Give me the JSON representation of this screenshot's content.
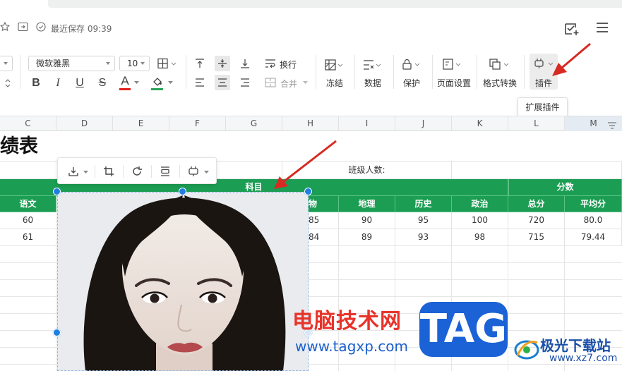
{
  "title_bar": {
    "save_status": "最近保存 09:39"
  },
  "toolbar": {
    "font_name": "微软雅黑",
    "font_size": "10",
    "wrap_label": "换行",
    "merge_label": "合并",
    "freeze_label": "冻结",
    "data_label": "数据",
    "protect_label": "保护",
    "page_setup_label": "页面设置",
    "format_convert_label": "格式转换",
    "plugin_label": "插件",
    "bold": "B",
    "italic": "I",
    "underline": "U",
    "strike": "S",
    "font_color": "A",
    "colors": {
      "font_color": "#e0201c",
      "fill_color": "#2aa55a"
    }
  },
  "tooltip": {
    "text": "扩展插件"
  },
  "columns": [
    "C",
    "D",
    "E",
    "F",
    "G",
    "H",
    "I",
    "J",
    "K",
    "L",
    "M"
  ],
  "sheet": {
    "title_fragment": "绩表",
    "class_count_label": "班级人数:",
    "group_subject": "科目",
    "group_score": "分数",
    "headers": [
      "语文",
      "物",
      "地理",
      "历史",
      "政治",
      "总分",
      "平均分"
    ],
    "rows": [
      [
        "60",
        "85",
        "90",
        "95",
        "100",
        "720",
        "80.0"
      ],
      [
        "61",
        "84",
        "89",
        "93",
        "98",
        "715",
        "79.44"
      ]
    ],
    "accent_color": "#1b9e53"
  },
  "watermarks": {
    "site_cn": "电脑技术网",
    "site_url": "www.tagxp.com",
    "tag": "TAG",
    "jiguang": "极光下载站",
    "jiguang_url": "www.xz7.com"
  },
  "icons": [
    "star-icon",
    "move-icon",
    "cloud-check-icon",
    "share-check-icon",
    "menu-icon",
    "plugin-icon",
    "crop-icon",
    "rotate-icon",
    "download-icon"
  ],
  "annotation_color": "#d62a22"
}
